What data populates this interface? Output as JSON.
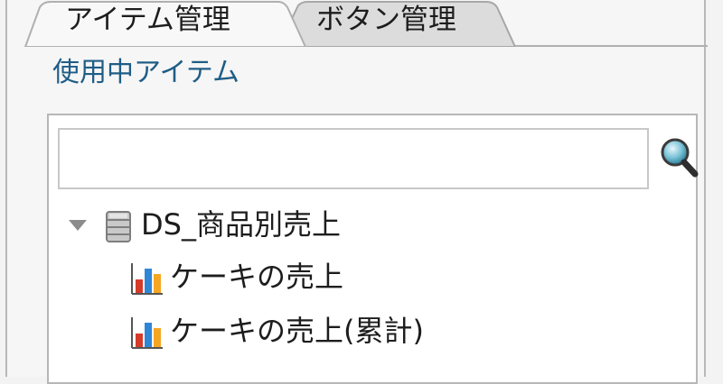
{
  "tabs": [
    {
      "label": "アイテム管理",
      "active": true
    },
    {
      "label": "ボタン管理",
      "active": false
    }
  ],
  "section": {
    "title": "使用中アイテム"
  },
  "search": {
    "value": "",
    "placeholder": "",
    "icon": "search-icon"
  },
  "tree": {
    "root": {
      "label": "DS_商品別売上",
      "expanded": true,
      "toggle_icon": "triangle-down-icon",
      "icon": "database-icon"
    },
    "children": [
      {
        "label": "ケーキの売上",
        "icon": "bar-chart-icon"
      },
      {
        "label": "ケーキの売上(累計)",
        "icon": "bar-chart-icon"
      }
    ]
  },
  "colors": {
    "section_title": "#1f5d86",
    "tab_active": "#f8f8f8",
    "tab_inactive": "#dcdcdc",
    "panel_border": "#b8b8b8",
    "chart_red": "#d63b2a",
    "chart_blue": "#2f86d6",
    "chart_orange": "#f5a623"
  }
}
